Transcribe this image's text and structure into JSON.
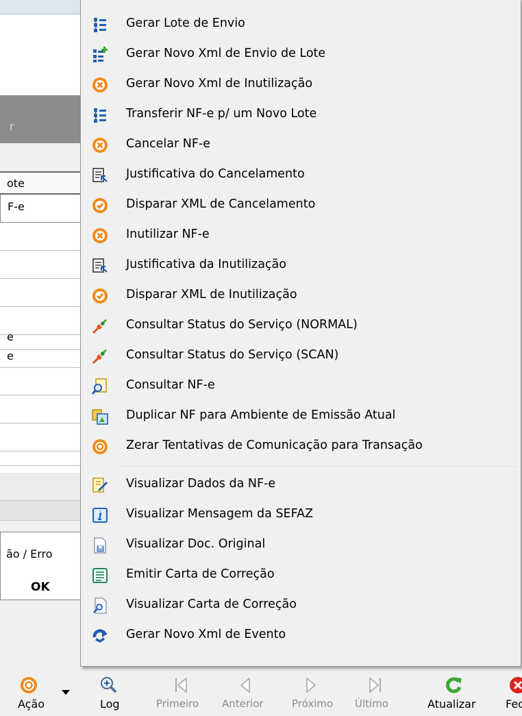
{
  "background": {
    "toolbar_cut_text": "r",
    "grid_header": "ote",
    "grid_rows": [
      "F-e",
      "",
      "",
      "",
      "",
      "e",
      "e",
      "",
      "",
      "",
      ""
    ],
    "error_column_label": "ão / Erro",
    "ok_label": "OK"
  },
  "menu": {
    "items": [
      {
        "label": "Gerar Lote de Envio",
        "icon": "tree-icon"
      },
      {
        "label": "Gerar Novo Xml de Envio de Lote",
        "icon": "tree-add-icon"
      },
      {
        "label": "Gerar Novo Xml de Inutilização",
        "icon": "orange-cancel-icon"
      },
      {
        "label": "Transferir NF-e p/ um Novo Lote",
        "icon": "tree-icon"
      },
      {
        "label": "Cancelar NF-e",
        "icon": "orange-cancel-icon"
      },
      {
        "label": "Justificativa do Cancelamento",
        "icon": "document-arrow-icon"
      },
      {
        "label": "Disparar XML de Cancelamento",
        "icon": "orange-check-icon"
      },
      {
        "label": "Inutilizar NF-e",
        "icon": "orange-cancel-icon"
      },
      {
        "label": "Justificativa da Inutilização",
        "icon": "document-arrow-icon"
      },
      {
        "label": "Disparar XML de Inutilização",
        "icon": "orange-check-icon"
      },
      {
        "label": "Consultar Status do Serviço (NORMAL)",
        "icon": "plug-icon"
      },
      {
        "label": "Consultar Status do Serviço (SCAN)",
        "icon": "plug-icon"
      },
      {
        "label": "Consultar NF-e",
        "icon": "document-search-icon"
      },
      {
        "label": "Duplicar NF para Ambiente de Emissão Atual",
        "icon": "duplicate-icon"
      },
      {
        "label": "Zerar Tentativas de Comunicação para Transação",
        "icon": "orange-target-icon"
      },
      {
        "label": "Visualizar Dados da NF-e",
        "icon": "document-edit-icon"
      },
      {
        "label": "Visualizar Mensagem da SEFAZ",
        "icon": "info-icon"
      },
      {
        "label": "Visualizar Doc. Original",
        "icon": "document-save-icon"
      },
      {
        "label": "Emitir Carta de Correção",
        "icon": "list-icon"
      },
      {
        "label": "Visualizar Carta de Correção",
        "icon": "document-view-icon"
      },
      {
        "label": "Gerar Novo Xml de Evento",
        "icon": "refresh-arrow-icon"
      }
    ]
  },
  "toolbar": {
    "acao": "Ação",
    "log": "Log",
    "primeiro": "Primeiro",
    "anterior": "Anterior",
    "proximo": "Próximo",
    "ultimo": "Último",
    "atualizar": "Atualizar",
    "fechar": "Fec"
  },
  "colors": {
    "orange": "#f08a1c",
    "blue": "#1f5fb0",
    "green": "#3aa832",
    "red": "#d8261c",
    "disabled": "#8d8d8d"
  }
}
